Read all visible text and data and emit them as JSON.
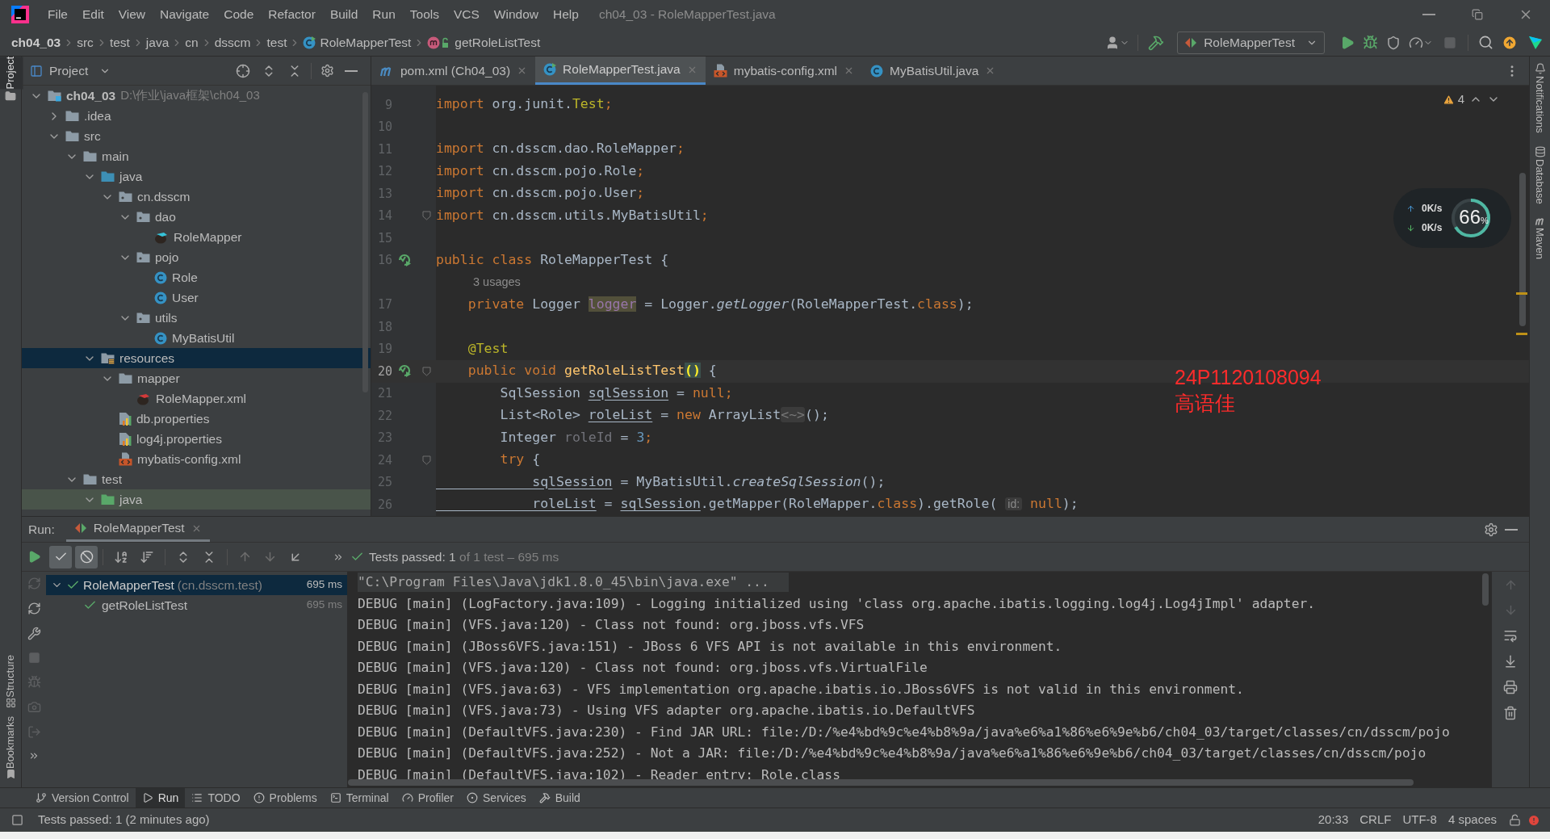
{
  "window": {
    "title": "ch04_03 - RoleMapperTest.java"
  },
  "menu": [
    "File",
    "Edit",
    "View",
    "Navigate",
    "Code",
    "Refactor",
    "Build",
    "Run",
    "Tools",
    "VCS",
    "Window",
    "Help"
  ],
  "breadcrumbs": [
    {
      "label": "ch04_03",
      "kind": "module"
    },
    {
      "label": "src",
      "kind": "dir"
    },
    {
      "label": "test",
      "kind": "dir"
    },
    {
      "label": "java",
      "kind": "dir"
    },
    {
      "label": "cn",
      "kind": "dir"
    },
    {
      "label": "dsscm",
      "kind": "dir"
    },
    {
      "label": "test",
      "kind": "dir"
    },
    {
      "label": "RoleMapperTest",
      "kind": "class"
    },
    {
      "label": "getRoleListTest",
      "kind": "method"
    }
  ],
  "run_configuration": {
    "label": "RoleMapperTest"
  },
  "side_tabs": {
    "left_top": [
      {
        "label": "Project",
        "selected": true
      }
    ],
    "left_bottom": [
      "Structure",
      "Bookmarks"
    ],
    "right": [
      "Notifications",
      "Database",
      "Maven"
    ]
  },
  "project_panel": {
    "title": "Project",
    "tree": [
      {
        "label": "ch04_03",
        "path": "D:\\作业\\java框架\\ch04_03",
        "kind": "module",
        "expanded": true,
        "selected": false,
        "children": [
          {
            "label": ".idea",
            "kind": "folder",
            "expanded": false,
            "selected": false
          },
          {
            "label": "src",
            "kind": "folder",
            "expanded": true,
            "selected": false,
            "children": [
              {
                "label": "main",
                "kind": "folder",
                "expanded": true,
                "selected": false,
                "children": [
                  {
                    "label": "java",
                    "kind": "source_root",
                    "expanded": true,
                    "selected": false,
                    "children": [
                      {
                        "label": "cn.dsscm",
                        "kind": "package",
                        "expanded": true,
                        "selected": false,
                        "children": [
                          {
                            "label": "dao",
                            "kind": "package",
                            "expanded": true,
                            "selected": false,
                            "children": [
                              {
                                "label": "RoleMapper",
                                "kind": "mapper",
                                "selected": false
                              }
                            ]
                          },
                          {
                            "label": "pojo",
                            "kind": "package",
                            "expanded": true,
                            "selected": false,
                            "children": [
                              {
                                "label": "Role",
                                "kind": "class",
                                "selected": false
                              },
                              {
                                "label": "User",
                                "kind": "class",
                                "selected": false
                              }
                            ]
                          },
                          {
                            "label": "utils",
                            "kind": "package",
                            "expanded": true,
                            "selected": false,
                            "children": [
                              {
                                "label": "MyBatisUtil",
                                "kind": "class",
                                "selected": false
                              }
                            ]
                          }
                        ]
                      }
                    ]
                  },
                  {
                    "label": "resources",
                    "kind": "resources_root",
                    "expanded": true,
                    "selected": true,
                    "children": [
                      {
                        "label": "mapper",
                        "kind": "folder",
                        "expanded": true,
                        "selected": false,
                        "children": [
                          {
                            "label": "RoleMapper.xml",
                            "kind": "mapper_xml",
                            "selected": false
                          }
                        ]
                      },
                      {
                        "label": "db.properties",
                        "kind": "properties",
                        "selected": false
                      },
                      {
                        "label": "log4j.properties",
                        "kind": "properties",
                        "selected": false
                      },
                      {
                        "label": "mybatis-config.xml",
                        "kind": "xml",
                        "selected": false
                      }
                    ]
                  }
                ]
              },
              {
                "label": "test",
                "kind": "folder",
                "expanded": true,
                "selected": false,
                "children": [
                  {
                    "label": "java",
                    "kind": "test_root",
                    "expanded": true,
                    "selected": false
                  }
                ]
              }
            ]
          }
        ]
      }
    ]
  },
  "editor": {
    "tabs": [
      {
        "label": "pom.xml (Ch04_03)",
        "kind": "maven",
        "selected": false
      },
      {
        "label": "RoleMapperTest.java",
        "kind": "test_class",
        "selected": true
      },
      {
        "label": "mybatis-config.xml",
        "kind": "xml",
        "selected": false
      },
      {
        "label": "MyBatisUtil.java",
        "kind": "class",
        "selected": false
      }
    ],
    "warnings": "4",
    "lines": [
      {
        "n": "9",
        "run": false,
        "fold": false,
        "current": false,
        "tokens": [
          {
            "text": "import",
            "kind": "kw"
          },
          {
            "text": " org.junit.",
            "kind": "plain"
          },
          {
            "text": "Test",
            "kind": "ann"
          },
          {
            "text": ";",
            "kind": "kw"
          }
        ]
      },
      {
        "n": "10",
        "run": false,
        "fold": false,
        "current": false
      },
      {
        "n": "11",
        "run": false,
        "fold": false,
        "current": false,
        "tokens": [
          {
            "text": "import",
            "kind": "kw"
          },
          {
            "text": " cn.dsscm.dao.RoleMapper",
            "kind": "plain"
          },
          {
            "text": ";",
            "kind": "kw"
          }
        ]
      },
      {
        "n": "12",
        "run": false,
        "fold": false,
        "current": false,
        "tokens": [
          {
            "text": "import",
            "kind": "kw"
          },
          {
            "text": " cn.dsscm.pojo.Role",
            "kind": "plain"
          },
          {
            "text": ";",
            "kind": "kw"
          }
        ]
      },
      {
        "n": "13",
        "run": false,
        "fold": false,
        "current": false,
        "tokens": [
          {
            "text": "import",
            "kind": "kw"
          },
          {
            "text": " cn.dsscm.pojo.User",
            "kind": "plain"
          },
          {
            "text": ";",
            "kind": "kw"
          }
        ]
      },
      {
        "n": "14",
        "run": false,
        "fold": true,
        "current": false,
        "tokens": [
          {
            "text": "import",
            "kind": "kw"
          },
          {
            "text": " cn.dsscm.utils.MyBatisUtil",
            "kind": "plain"
          },
          {
            "text": ";",
            "kind": "kw"
          }
        ]
      },
      {
        "n": "15",
        "run": false,
        "fold": false,
        "current": false
      },
      {
        "n": "16",
        "run": true,
        "fold": false,
        "current": false,
        "tokens": [
          {
            "text": "public class",
            "kind": "kw"
          },
          {
            "text": " RoleMapperTest {",
            "kind": "plain"
          }
        ]
      },
      {
        "n": "17",
        "run": false,
        "fold": false,
        "current": false,
        "hint": "3 usages",
        "tokens": [
          {
            "text": "    private",
            "kind": "kw"
          },
          {
            "text": " Logger ",
            "kind": "plain"
          },
          {
            "text": "logger",
            "kind": "field_hl"
          },
          {
            "text": " = Logger.",
            "kind": "plain"
          },
          {
            "text": "getLogger",
            "kind": "ital"
          },
          {
            "text": "(RoleMapperTest.",
            "kind": "plain"
          },
          {
            "text": "class",
            "kind": "kw"
          },
          {
            "text": ");",
            "kind": "plain"
          }
        ]
      },
      {
        "n": "18",
        "run": false,
        "fold": false,
        "current": false
      },
      {
        "n": "19",
        "run": false,
        "fold": false,
        "current": false,
        "tokens": [
          {
            "text": "    @Test",
            "kind": "ann"
          }
        ]
      },
      {
        "n": "20",
        "run": true,
        "fold": true,
        "current": true,
        "tokens": [
          {
            "text": "    public void ",
            "kind": "kw"
          },
          {
            "text": "getRoleListTest",
            "kind": "method"
          },
          {
            "text": "()",
            "kind": "match"
          },
          {
            "text": " {",
            "kind": "plain"
          }
        ]
      },
      {
        "n": "21",
        "run": false,
        "fold": false,
        "current": false,
        "tokens": [
          {
            "text": "        SqlSession ",
            "kind": "plain"
          },
          {
            "text": "sqlSession",
            "kind": "under"
          },
          {
            "text": " = ",
            "kind": "plain"
          },
          {
            "text": "null",
            "kind": "kw"
          },
          {
            "text": ";",
            "kind": "kw"
          }
        ]
      },
      {
        "n": "22",
        "run": false,
        "fold": false,
        "current": false,
        "tokens": [
          {
            "text": "        List<Role> ",
            "kind": "plain"
          },
          {
            "text": "roleList",
            "kind": "under"
          },
          {
            "text": " = ",
            "kind": "plain"
          },
          {
            "text": "new",
            "kind": "kw"
          },
          {
            "text": " ArrayList",
            "kind": "plain"
          },
          {
            "text": "<~>",
            "kind": "fold"
          },
          {
            "text": "();",
            "kind": "plain"
          }
        ]
      },
      {
        "n": "23",
        "run": false,
        "fold": false,
        "current": false,
        "tokens": [
          {
            "text": "        Integer ",
            "kind": "plain"
          },
          {
            "text": "roleId",
            "kind": "unused"
          },
          {
            "text": " = ",
            "kind": "plain"
          },
          {
            "text": "3",
            "kind": "num"
          },
          {
            "text": ";",
            "kind": "kw"
          }
        ]
      },
      {
        "n": "24",
        "run": false,
        "fold": true,
        "current": false,
        "tokens": [
          {
            "text": "        try",
            "kind": "kw"
          },
          {
            "text": " {",
            "kind": "plain"
          }
        ]
      },
      {
        "n": "25",
        "run": false,
        "fold": false,
        "current": false,
        "tokens": [
          {
            "text": "            sqlSession",
            "kind": "under"
          },
          {
            "text": " = MyBatisUtil.",
            "kind": "plain"
          },
          {
            "text": "createSqlSession",
            "kind": "ital"
          },
          {
            "text": "();",
            "kind": "plain"
          }
        ]
      },
      {
        "n": "26",
        "run": false,
        "fold": false,
        "current": false,
        "tokens": [
          {
            "text": "            roleList",
            "kind": "under"
          },
          {
            "text": " = ",
            "kind": "plain"
          },
          {
            "text": "sqlSession",
            "kind": "under"
          },
          {
            "text": ".getMapper(RoleMapper.",
            "kind": "plain"
          },
          {
            "text": "class",
            "kind": "kw"
          },
          {
            "text": ").getRole( ",
            "kind": "plain"
          },
          {
            "text": "id:",
            "kind": "hint"
          },
          {
            "text": " null",
            "kind": "kw"
          },
          {
            "text": ");",
            "kind": "plain"
          }
        ]
      }
    ],
    "annotation": [
      "24P1120108094",
      "高语佳"
    ]
  },
  "network_widget": {
    "upload": "0K/s",
    "download": "0K/s",
    "percent": "66",
    "unit": "%",
    "level": 0.66
  },
  "run_panel": {
    "label": "Run:",
    "tab": "RoleMapperTest",
    "filters": [
      {
        "kind": "show_passed",
        "selected": true
      },
      {
        "kind": "show_ignored",
        "selected": true
      }
    ],
    "status_main": "Tests passed: 1",
    "status_detail": "of 1 test – 695 ms",
    "tests": [
      {
        "label": "RoleMapperTest",
        "package": "(cn.dsscm.test)",
        "time": "695 ms",
        "passed": true,
        "selected": true,
        "expanded": true,
        "children": [
          {
            "label": "getRoleListTest",
            "time": "695 ms",
            "passed": true,
            "selected": false
          }
        ]
      }
    ],
    "console": [
      {
        "kind": "command",
        "text": "\"C:\\Program Files\\Java\\jdk1.8.0_45\\bin\\java.exe\" ..."
      },
      {
        "kind": "log",
        "text": "DEBUG [main] (LogFactory.java:109) - Logging initialized using 'class org.apache.ibatis.logging.log4j.Log4jImpl' adapter."
      },
      {
        "kind": "log",
        "text": "DEBUG [main] (VFS.java:120) - Class not found: org.jboss.vfs.VFS"
      },
      {
        "kind": "log",
        "text": "DEBUG [main] (JBoss6VFS.java:151) - JBoss 6 VFS API is not available in this environment."
      },
      {
        "kind": "log",
        "text": "DEBUG [main] (VFS.java:120) - Class not found: org.jboss.vfs.VirtualFile"
      },
      {
        "kind": "log",
        "text": "DEBUG [main] (VFS.java:63) - VFS implementation org.apache.ibatis.io.JBoss6VFS is not valid in this environment."
      },
      {
        "kind": "log",
        "text": "DEBUG [main] (VFS.java:73) - Using VFS adapter org.apache.ibatis.io.DefaultVFS"
      },
      {
        "kind": "log",
        "text": "DEBUG [main] (DefaultVFS.java:230) - Find JAR URL: file:/D:/%e4%bd%9c%e4%b8%9a/java%e6%a1%86%e6%9e%b6/ch04_03/target/classes/cn/dsscm/pojo"
      },
      {
        "kind": "log",
        "text": "DEBUG [main] (DefaultVFS.java:252) - Not a JAR: file:/D:/%e4%bd%9c%e4%b8%9a/java%e6%a1%86%e6%9e%b6/ch04_03/target/classes/cn/dsscm/pojo"
      },
      {
        "kind": "log",
        "text": "DEBUG [main] (DefaultVFS.java:102) - Reader entry: Role.class"
      }
    ]
  },
  "tool_tabs": [
    {
      "label": "Version Control",
      "kind": "vcs",
      "selected": false
    },
    {
      "label": "Run",
      "kind": "run",
      "selected": true
    },
    {
      "label": "TODO",
      "kind": "todo",
      "selected": false
    },
    {
      "label": "Problems",
      "kind": "problems",
      "selected": false
    },
    {
      "label": "Terminal",
      "kind": "terminal",
      "selected": false
    },
    {
      "label": "Profiler",
      "kind": "profiler",
      "selected": false
    },
    {
      "label": "Services",
      "kind": "services",
      "selected": false
    },
    {
      "label": "Build",
      "kind": "build",
      "selected": false
    }
  ],
  "status_bar": {
    "message": "Tests passed: 1 (2 minutes ago)",
    "items": [
      "20:33",
      "CRLF",
      "UTF-8",
      "4 spaces"
    ]
  }
}
